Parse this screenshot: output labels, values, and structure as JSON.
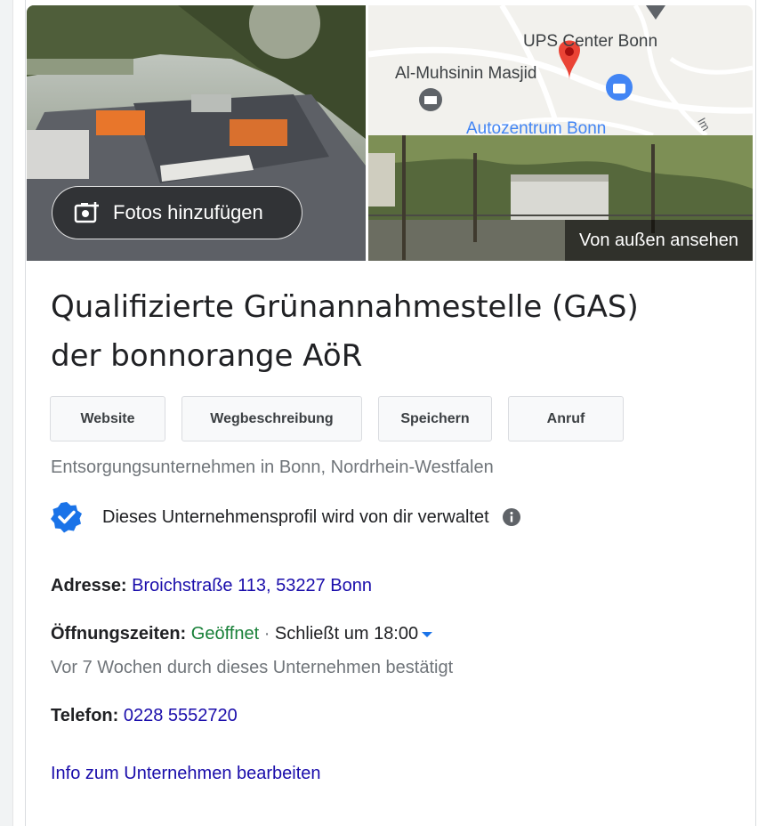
{
  "media": {
    "add_photos_label": "Fotos hinzufügen",
    "street_view_label": "Von außen ansehen",
    "map": {
      "labels": [
        "UPS Center Bonn",
        "Al-Muhsinin Masjid",
        "Autozentrum Bonn",
        "Im"
      ]
    }
  },
  "business": {
    "name_line1": "Qualifizierte Grünannahmestelle (GAS)",
    "name_line2": "der bonnorange AöR",
    "category": "Entsorgungsunternehmen in Bonn, Nordrhein-Westfalen",
    "verified_text": "Dieses Unternehmensprofil wird von dir verwaltet"
  },
  "actions": {
    "website": "Website",
    "directions": "Wegbeschreibung",
    "save": "Speichern",
    "call": "Anruf"
  },
  "details": {
    "address_label": "Adresse:",
    "address_value": "Broichstraße 113, 53227 Bonn",
    "hours_label": "Öffnungszeiten:",
    "hours_status": "Geöffnet",
    "hours_separator": " · ",
    "hours_closing": "Schließt um 18:00",
    "hours_confirmed": "Vor 7 Wochen durch dieses Unternehmen bestätigt",
    "phone_label": "Telefon:",
    "phone_value": "0228 5552720",
    "edit_link": "Info zum Unternehmen bearbeiten"
  },
  "colors": {
    "link": "#1a0dab",
    "open": "#188038",
    "verified_badge": "#1a73e8",
    "map_pin": "#ea4335"
  }
}
